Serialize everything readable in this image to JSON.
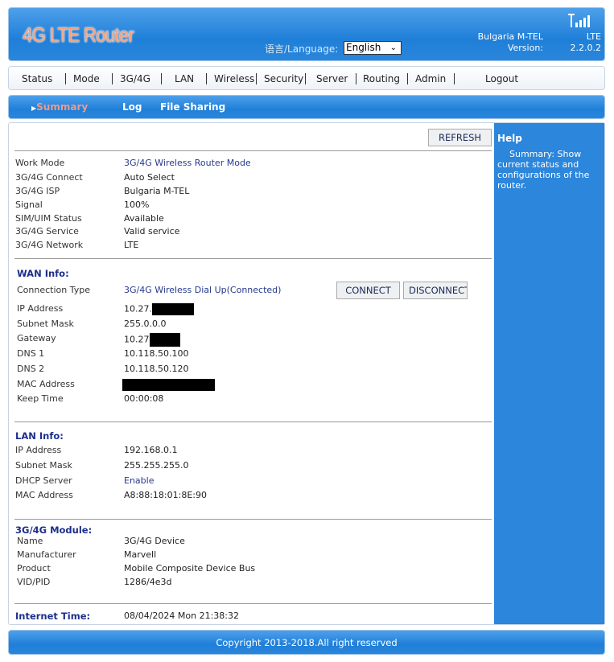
{
  "header": {
    "title": "4G LTE Router",
    "language_label": "语言/Language:",
    "language_value": "English",
    "isp": "Bulgaria M-TEL",
    "network": "LTE",
    "version_label": "Version:",
    "version": "2.2.0.2",
    "signal_icon": "signal-bars-icon"
  },
  "nav": [
    "Status",
    "Mode",
    "3G/4G",
    "LAN",
    "Wireless",
    "Security",
    "Server",
    "Routing",
    "Admin",
    "Logout"
  ],
  "subnav": {
    "items": [
      "Summary",
      "Log",
      "File Sharing"
    ],
    "active": "Summary"
  },
  "refresh": "REFRESH",
  "status": [
    {
      "label": "Work Mode",
      "value": "3G/4G Wireless Router Mode"
    },
    {
      "label": "3G/4G Connect",
      "value": "Auto Select"
    },
    {
      "label": "3G/4G ISP",
      "value": "Bulgaria M-TEL"
    },
    {
      "label": "Signal",
      "value": "100%"
    },
    {
      "label": "SIM/UIM Status",
      "value": "Available"
    },
    {
      "label": "3G/4G Service",
      "value": "Valid service"
    },
    {
      "label": "3G/4G Network",
      "value": "LTE"
    }
  ],
  "wan": {
    "title": "WAN Info:",
    "connect": "CONNECT",
    "disconnect": "DISCONNECT",
    "rows": [
      {
        "label": "Connection Type",
        "value": "3G/4G Wireless Dial Up(Connected)"
      },
      {
        "label": "IP Address",
        "value": "10.27."
      },
      {
        "label": "Subnet Mask",
        "value": "255.0.0.0"
      },
      {
        "label": "Gateway",
        "value": "10.27"
      },
      {
        "label": "DNS 1",
        "value": "10.118.50.100"
      },
      {
        "label": "DNS 2",
        "value": "10.118.50.120"
      },
      {
        "label": "MAC Address",
        "value": ""
      },
      {
        "label": "Keep Time",
        "value": "00:00:08"
      }
    ]
  },
  "lan": {
    "title": "LAN Info:",
    "rows": [
      {
        "label": "IP Address",
        "value": "192.168.0.1"
      },
      {
        "label": "Subnet Mask",
        "value": "255.255.255.0"
      },
      {
        "label": "DHCP Server",
        "value": "Enable"
      },
      {
        "label": "MAC Address",
        "value": "A8:88:18:01:8E:90"
      }
    ]
  },
  "module": {
    "title": "3G/4G Module:",
    "rows": [
      {
        "label": "Name",
        "value": "3G/4G Device"
      },
      {
        "label": "Manufacturer",
        "value": "Marvell"
      },
      {
        "label": "Product",
        "value": "Mobile Composite Device Bus"
      },
      {
        "label": "VID/PID",
        "value": "1286/4e3d"
      }
    ]
  },
  "internet_time": {
    "label": "Internet Time:",
    "value": "08/04/2024 Mon 21:38:32"
  },
  "help": {
    "title": "Help",
    "text": "Summary: Show current status and configurations of the router."
  },
  "footer": "Copyright 2013-2018.All right reserved"
}
